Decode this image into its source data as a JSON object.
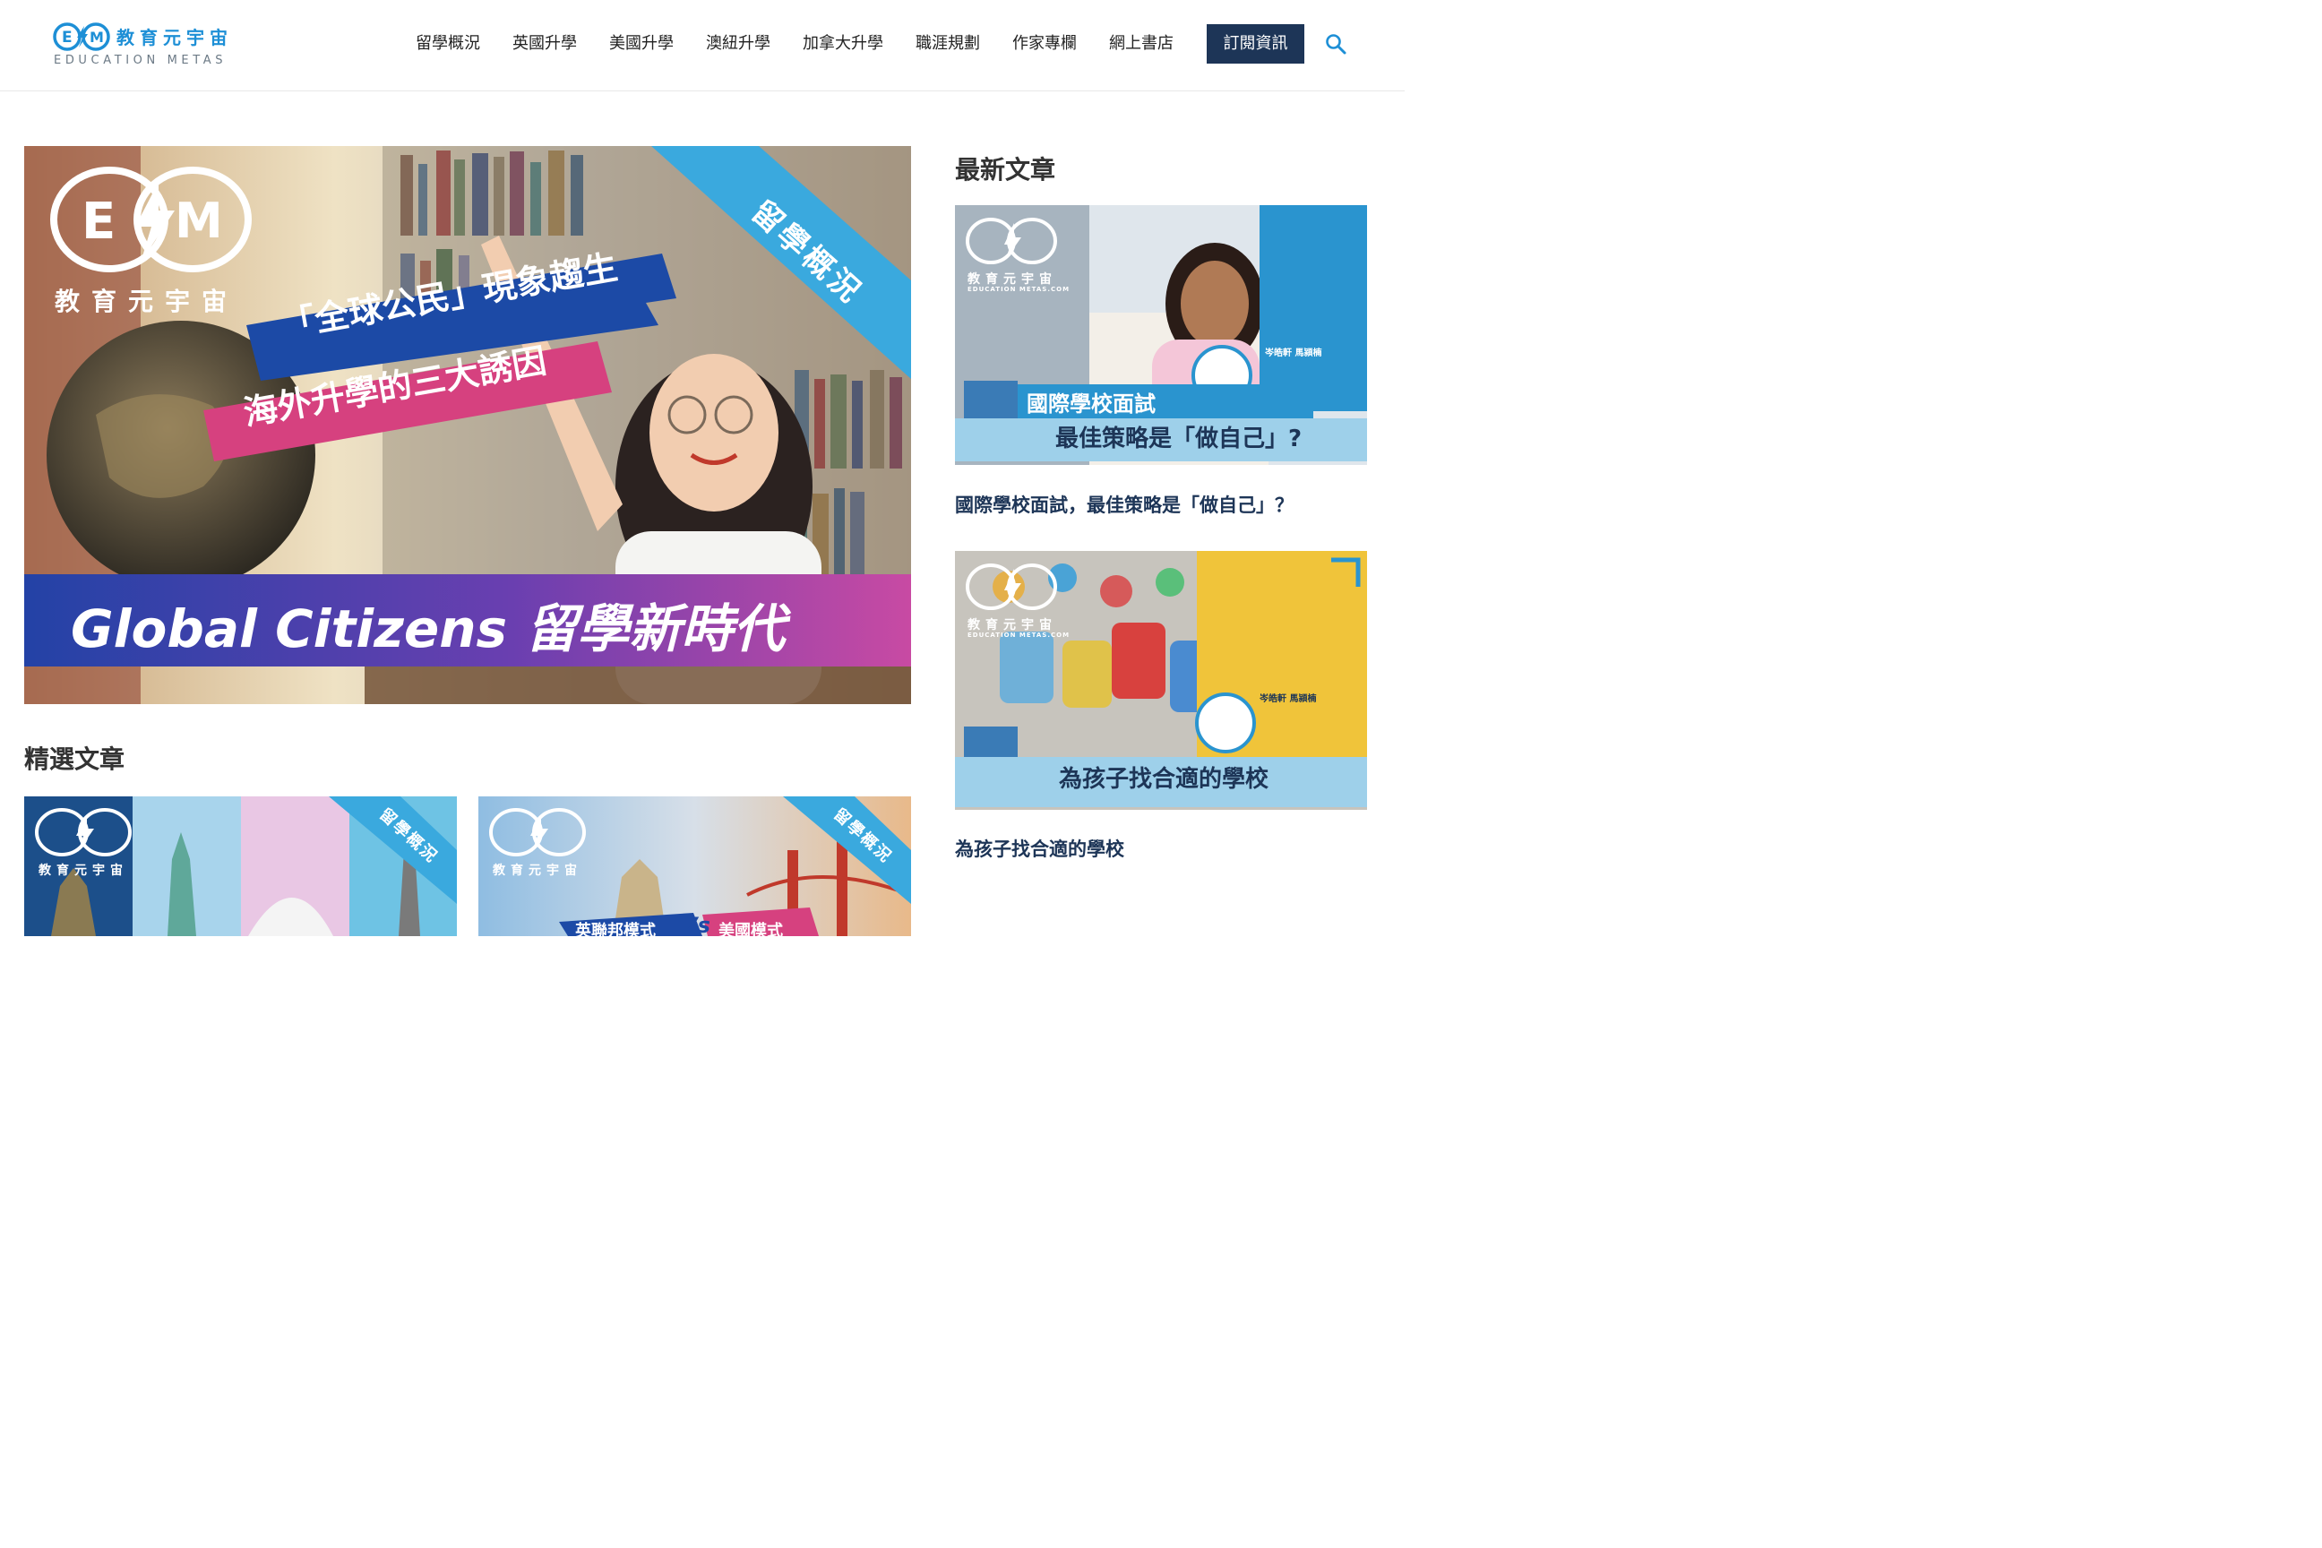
{
  "brand": {
    "logo_mark": "EM",
    "name_cn": "教育元宇宙",
    "name_en": "EDUCATION METAS"
  },
  "nav": {
    "items": [
      "留學概況",
      "英國升學",
      "美國升學",
      "澳紐升學",
      "加拿大升學",
      "職涯規劃",
      "作家專欄",
      "網上書店"
    ],
    "subscribe_label": "訂閱資訊",
    "search_icon": "search-icon"
  },
  "colors": {
    "accent_blue": "#1d8fd6",
    "navy": "#1d3557",
    "banner_blue": "#1c4aa6",
    "banner_pink": "#d6417f",
    "tag_cyan": "#3aa9de"
  },
  "hero": {
    "logo_mark": "EM",
    "logo_cn": "教育元宇宙",
    "tag": "留學概況",
    "headline_1": "「全球公民」現象趨生",
    "headline_2": "海外升學的三大誘因",
    "bottom_banner": "Global Citizens 留學新時代"
  },
  "featured": {
    "title": "精選文章",
    "cards": [
      {
        "logo_mark": "EM",
        "logo_cn": "教育元宇宙",
        "tag": "留學概況"
      },
      {
        "logo_mark": "EM",
        "logo_cn": "教育元宇宙",
        "tag": "留學概況",
        "banner_left": "英聯邦模式",
        "banner_vs": "Vs",
        "banner_right": "美國模式"
      }
    ]
  },
  "latest": {
    "title": "最新文章",
    "posts": [
      {
        "title": "國際學校面試，最佳策略是「做自己」？",
        "image_logo_mark": "EM",
        "image_logo_cn": "教育元宇宙",
        "image_logo_en": "EDUCATION METAS.COM",
        "image_banner_1": "國際學校面試",
        "image_banner_2": "最佳策略是「做自己」?",
        "image_author": "岑皓軒 馬潁楠"
      },
      {
        "title": "為孩子找合適的學校",
        "image_logo_mark": "EM",
        "image_logo_cn": "教育元宇宙",
        "image_logo_en": "EDUCATION METAS.COM",
        "image_banner_1": "為孩子找合適的學校",
        "image_author": "岑皓軒 馬潁楠"
      }
    ]
  }
}
